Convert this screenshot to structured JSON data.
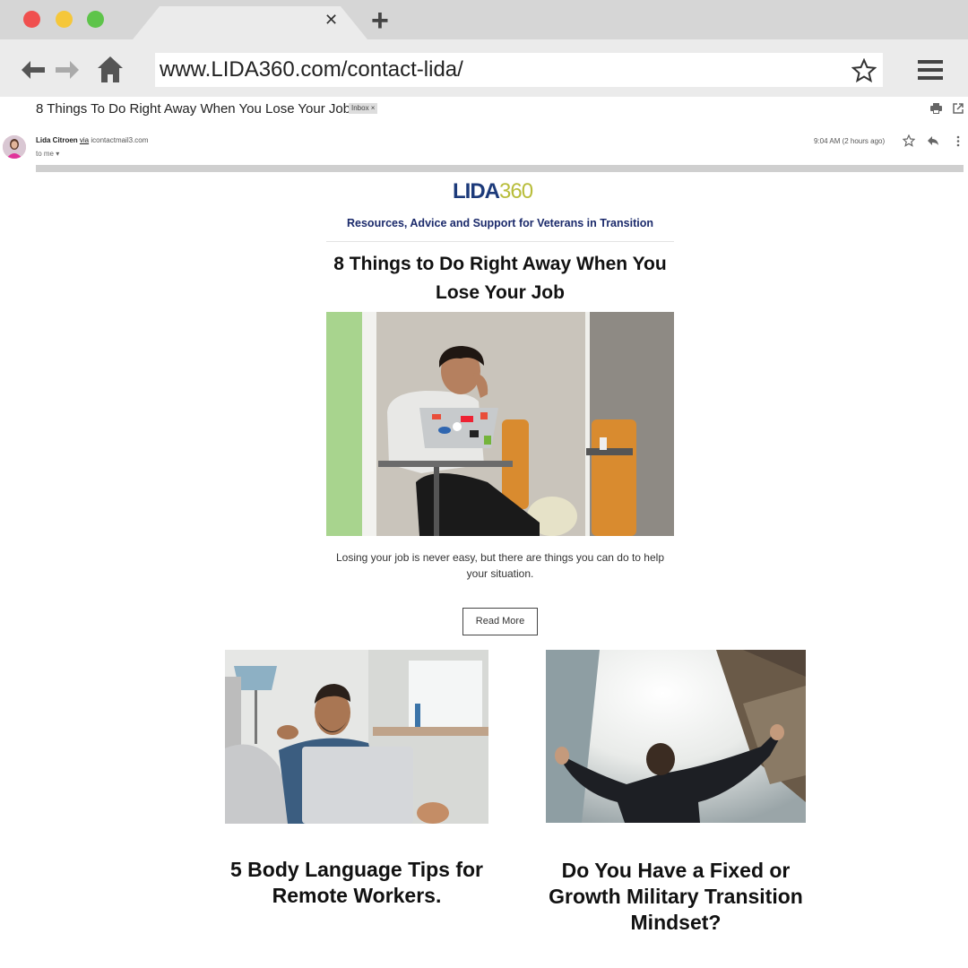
{
  "browser": {
    "url": "www.LIDA360.com/contact-lida/",
    "traffic_light_colors": {
      "close": "#f0504f",
      "minimize": "#f5c73a",
      "maximize": "#5ec44a"
    }
  },
  "email": {
    "subject": "8 Things To Do Right Away When You Lose Your Job",
    "label": "Inbox ×",
    "sender_name": "Lida Citroen",
    "sender_via": "via",
    "sender_domain": "icontactmail3.com",
    "recipient": "to me ▾",
    "timestamp": "9:04 AM (2 hours ago)"
  },
  "newsletter": {
    "logo_part1": "LIDA",
    "logo_part2": "360",
    "tagline": "Resources, Advice and Support for Veterans in Transition",
    "headline": "8 Things to Do Right Away When You Lose Your Job",
    "excerpt": "Losing your job is never easy, but there are things you can do to help your situation.",
    "read_more": "Read More",
    "articles": [
      {
        "title": "5 Body Language Tips for Remote Workers."
      },
      {
        "title": "Do You Have a Fixed or Growth Military Transition Mindset?"
      }
    ],
    "colors": {
      "brand_navy": "#1c3a7a",
      "brand_olive": "#b8bd3a"
    }
  }
}
